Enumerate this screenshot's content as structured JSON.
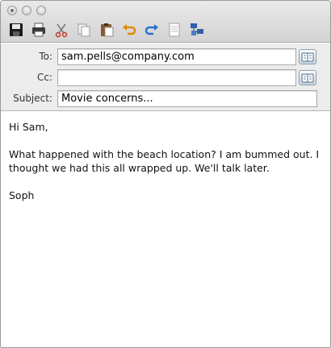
{
  "toolbar": {
    "buttons": [
      "save",
      "print",
      "cut",
      "copy",
      "paste",
      "undo",
      "redo",
      "attach",
      "network"
    ]
  },
  "header": {
    "to_label": "To:",
    "to_value": "sam.pells@company.com",
    "cc_label": "Cc:",
    "cc_value": "",
    "subject_label": "Subject:",
    "subject_value": "Movie concerns..."
  },
  "body": {
    "greeting": "Hi Sam,",
    "line1": "What happened with the beach location? I am bummed out. I",
    "line2": "thought we had this all wrapped up. We'll talk later.",
    "signature": "Soph"
  },
  "colors": {
    "chrome": "#dcdcdc",
    "fields_bg": "#ececec",
    "address_button": "#c7d3e0"
  }
}
